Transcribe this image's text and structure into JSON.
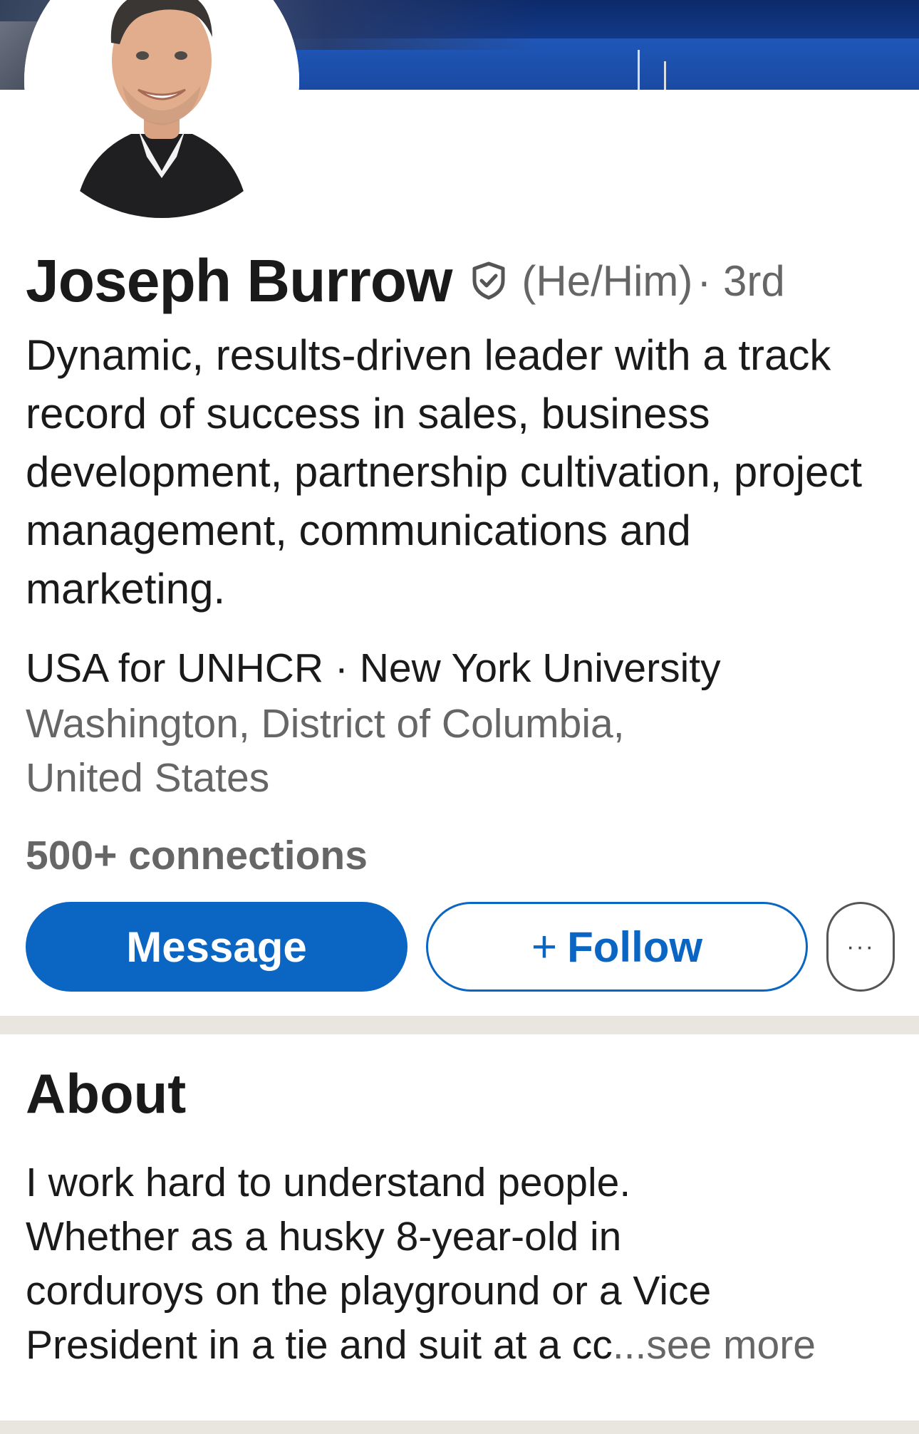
{
  "profile": {
    "name": "Joseph Burrow",
    "pronouns": "(He/Him)",
    "degree": "· 3rd",
    "headline": "Dynamic, results-driven leader with a track record of success in sales, business development, partnership cultivation, project management, communications and marketing.",
    "orgs": "USA for UNHCR · New York University",
    "location": "Washington, District of Columbia, United States",
    "connections": "500+ connections"
  },
  "actions": {
    "message_label": "Message",
    "follow_plus": "+",
    "follow_label": "Follow",
    "more_label": "···"
  },
  "about": {
    "title": "About",
    "lines": [
      "I work hard to understand people.",
      "Whether as a husky 8-year-old in",
      "corduroys on the playground or a Vice",
      "President in a tie and suit at a cc"
    ],
    "see_more": "...see more"
  },
  "colors": {
    "primary": "#0a66c2",
    "text": "#1a1a1a",
    "muted": "#666666",
    "divider": "#e9e5df"
  },
  "icons": {
    "verified": "shield-check-icon",
    "more": "ellipsis-icon"
  }
}
